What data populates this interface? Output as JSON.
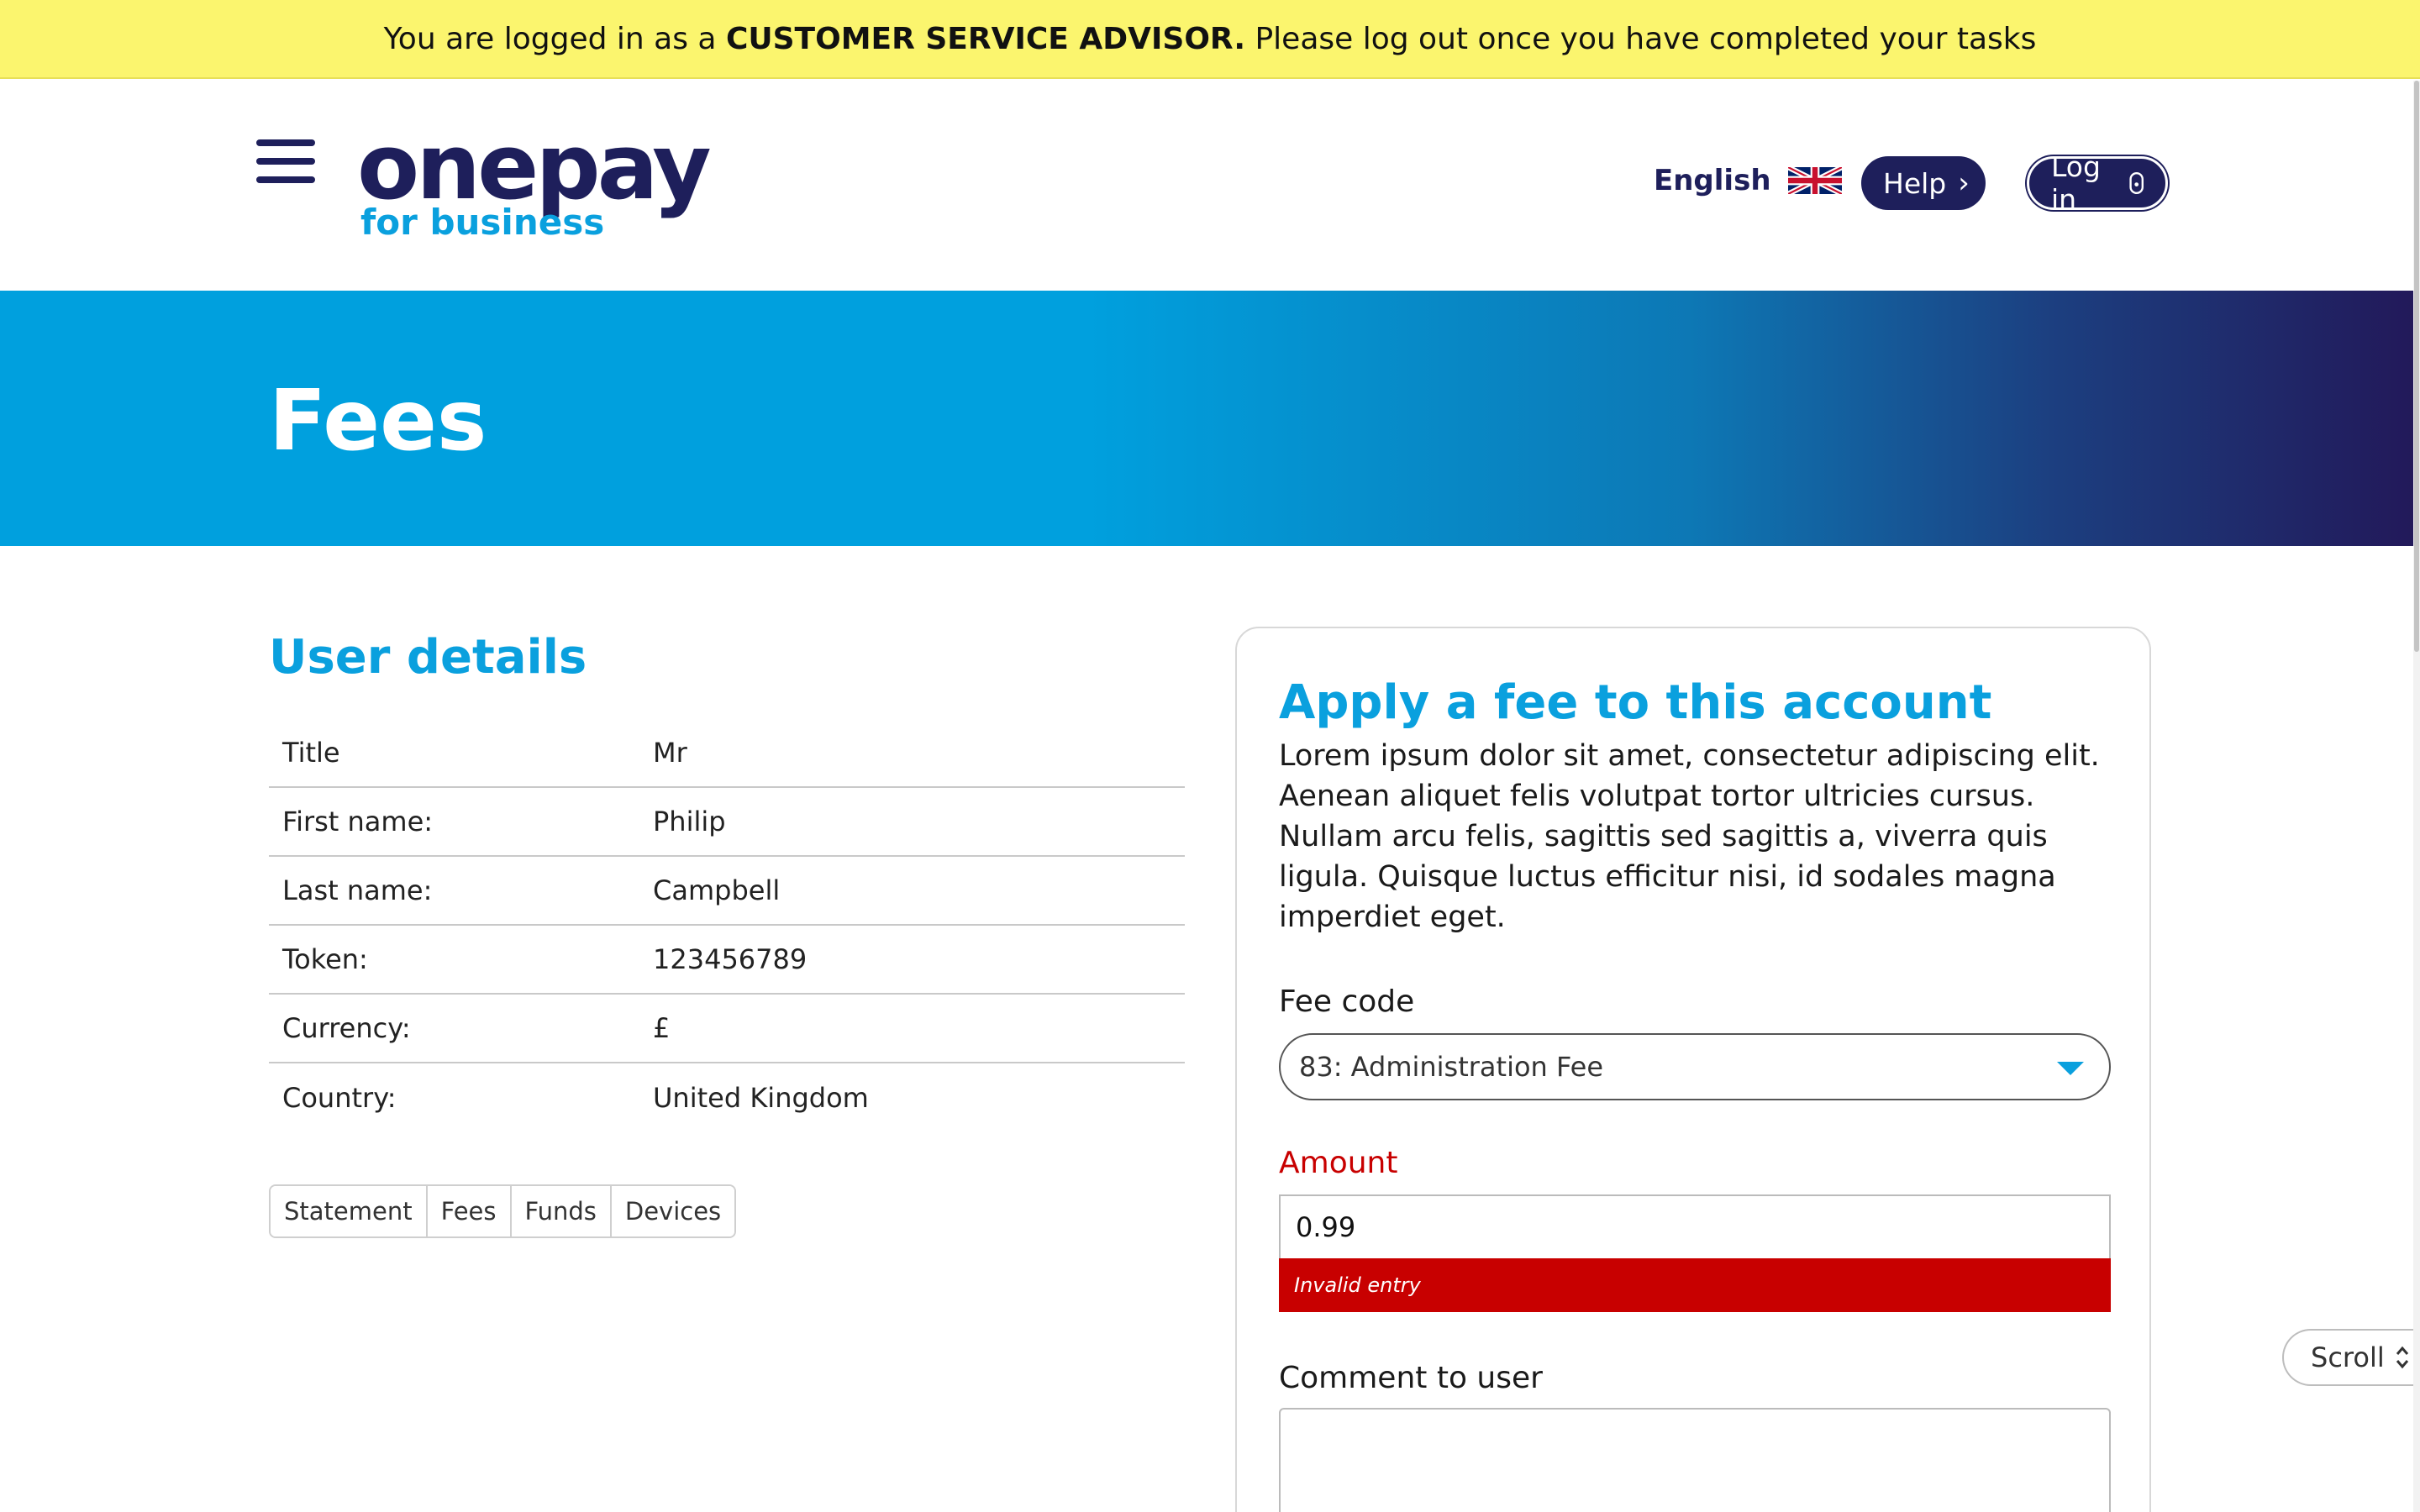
{
  "banner": {
    "prefix": "You are logged in as a",
    "role": "CUSTOMER SERVICE ADVISOR.",
    "suffix": "Please log out once you have completed your tasks"
  },
  "header": {
    "logo_main": "onepay",
    "logo_sub": "for business",
    "language": "English",
    "help_label": "Help",
    "login_label": "Log in"
  },
  "hero": {
    "title": "Fees"
  },
  "user_details": {
    "title": "User details",
    "rows": [
      {
        "key": "Title",
        "value": "Mr"
      },
      {
        "key": "First name:",
        "value": "Philip"
      },
      {
        "key": "Last name:",
        "value": "Campbell"
      },
      {
        "key": "Token:",
        "value": "123456789"
      },
      {
        "key": "Currency:",
        "value": "£"
      },
      {
        "key": "Country:",
        "value": "United Kingdom"
      }
    ],
    "tabs": [
      "Statement",
      "Fees",
      "Funds",
      "Devices"
    ]
  },
  "fee_form": {
    "title": "Apply a fee to this account",
    "intro": "Lorem ipsum dolor sit amet, consectetur adipiscing elit. Aenean aliquet felis volutpat tortor ultricies cursus. Nullam arcu felis, sagittis sed sagittis a, viverra quis ligula. Quisque luctus efficitur nisi, id sodales magna imperdiet eget.",
    "fee_code_label": "Fee code",
    "fee_code_value": "83: Administration Fee",
    "amount_label": "Amount",
    "amount_value": "0.99",
    "amount_error": "Invalid entry",
    "comment_label": "Comment to user",
    "comment_value": ""
  },
  "scroll_label": "Scroll",
  "colors": {
    "brand_navy": "#1e1f5b",
    "brand_blue": "#0aa0de",
    "banner_yellow": "#fbf56e",
    "error_red": "#c80000"
  }
}
